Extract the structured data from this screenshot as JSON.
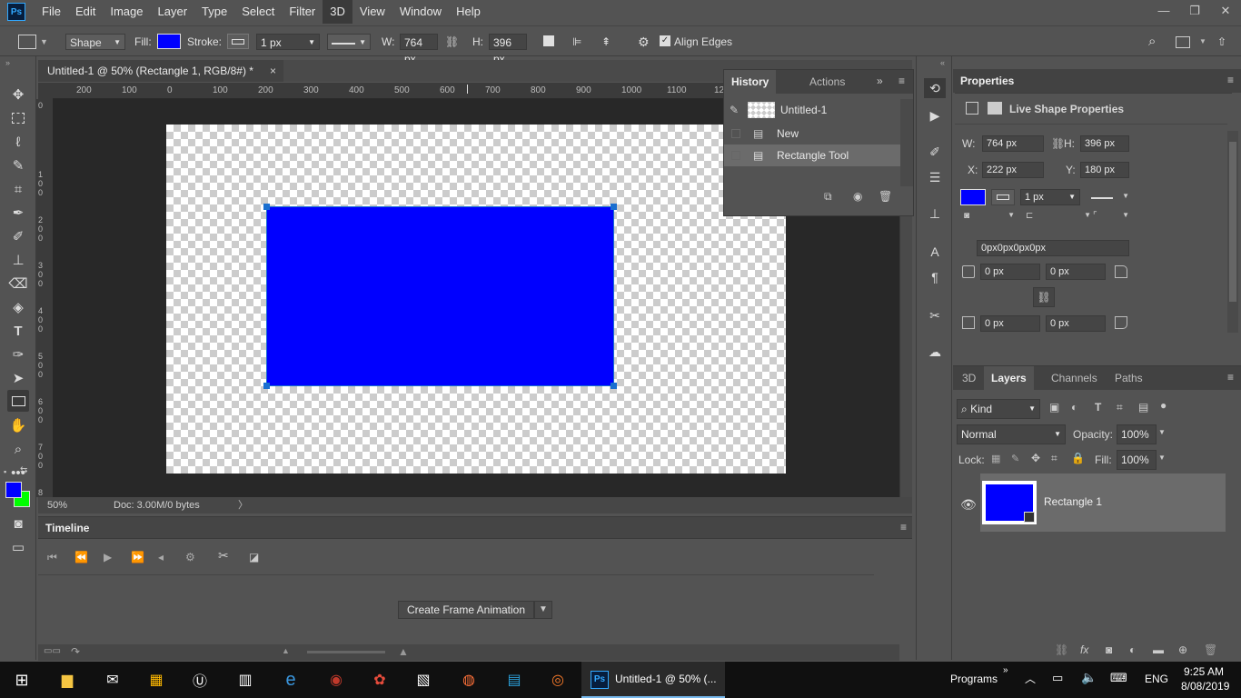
{
  "app": {
    "logo": "Ps"
  },
  "menu": [
    "File",
    "Edit",
    "Image",
    "Layer",
    "Type",
    "Select",
    "Filter",
    "3D",
    "View",
    "Window",
    "Help"
  ],
  "window_controls": {
    "minimize": "—",
    "restore": "❐",
    "close": "✕"
  },
  "options_bar": {
    "mode": "Shape",
    "fill_label": "Fill:",
    "fill_color": "#0000ff",
    "stroke_label": "Stroke:",
    "stroke_width": "1 px",
    "w_label": "W:",
    "w_value": "764 px",
    "h_label": "H:",
    "h_value": "396 px",
    "align_edges": "Align Edges"
  },
  "document": {
    "tab_title": "Untitled-1 @ 50% (Rectangle 1, RGB/8#) *",
    "close": "×",
    "zoom": "50%",
    "doc_info": "Doc: 3.00M/0 bytes",
    "shape_color": "#0000ff"
  },
  "rulers": {
    "h_ticks": [
      "200",
      "100",
      "0",
      "100",
      "200",
      "300",
      "400",
      "500",
      "600",
      "700",
      "800",
      "900",
      "1000",
      "1100",
      "12"
    ],
    "v_ticks": [
      "0",
      "1\n0\n0",
      "2\n0\n0",
      "3\n0\n0",
      "4\n0\n0",
      "5\n0\n0",
      "6\n0\n0",
      "7\n0\n0",
      "8"
    ]
  },
  "history": {
    "tabs": [
      "History",
      "Actions"
    ],
    "snapshot": "Untitled-1",
    "items": [
      "New",
      "Rectangle Tool"
    ]
  },
  "properties": {
    "title": "Properties",
    "subtitle": "Live Shape Properties",
    "w_label": "W:",
    "w_value": "764 px",
    "h_label": "H:",
    "h_value": "396 px",
    "x_label": "X:",
    "x_value": "222 px",
    "y_label": "Y:",
    "y_value": "180 px",
    "stroke_width": "1 px",
    "corner_summary": "0px0px0px0px",
    "corners": [
      "0 px",
      "0 px",
      "0 px",
      "0 px"
    ]
  },
  "layers": {
    "tabs": [
      "3D",
      "Layers",
      "Channels",
      "Paths"
    ],
    "kind": "Kind",
    "blend_mode": "Normal",
    "opacity_label": "Opacity:",
    "opacity": "100%",
    "lock_label": "Lock:",
    "fill_label": "Fill:",
    "fill": "100%",
    "layer_name": "Rectangle 1"
  },
  "timeline": {
    "title": "Timeline",
    "create_button": "Create Frame Animation"
  },
  "taskbar": {
    "ps_task": "Untitled-1 @ 50% (...",
    "programs": "Programs",
    "lang": "ENG",
    "time": "9:25 AM",
    "date": "8/08/2019"
  }
}
